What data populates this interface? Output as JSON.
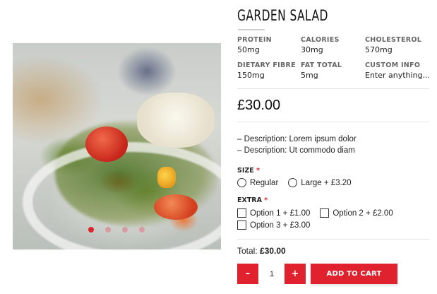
{
  "product": {
    "title": "GARDEN SALAD",
    "price": "£30.00",
    "image_alt": "",
    "carousel": {
      "slides": 4,
      "active_index": 0
    }
  },
  "nutrition": [
    {
      "label": "PROTEIN",
      "value": "50mg"
    },
    {
      "label": "CALORIES",
      "value": "30mg"
    },
    {
      "label": "CHOLESTEROL",
      "value": "570mg"
    },
    {
      "label": "DIETARY FIBRE",
      "value": "150mg"
    },
    {
      "label": "FAT TOTAL",
      "value": "5mg"
    },
    {
      "label": "CUSTOM INFO",
      "value": "Enter anything..."
    }
  ],
  "descriptions": [
    "– Description: Lorem ipsum dolor",
    "– Description: Ut commodo diam"
  ],
  "size": {
    "label": "SIZE",
    "required_mark": "*",
    "options": [
      "Regular",
      "Large + £3.20"
    ]
  },
  "extra": {
    "label": "EXTRA",
    "required_mark": "*",
    "options": [
      "Option 1 + £1.00",
      "Option 2 + £2.00",
      "Option 3 + £3.00"
    ]
  },
  "total": {
    "label": "Total:",
    "value": "£30.00"
  },
  "quantity": {
    "minus": "–",
    "value": "1",
    "plus": "+"
  },
  "add_to_cart": "ADD TO CART",
  "colors": {
    "accent": "#e0222f",
    "text": "#222222",
    "muted": "#666666"
  }
}
